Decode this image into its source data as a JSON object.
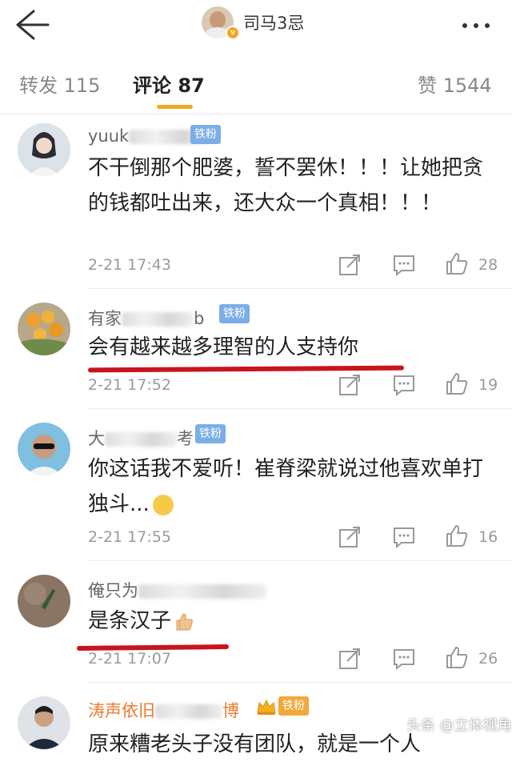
{
  "header": {
    "title": "司马3忌",
    "verified_badge": "v"
  },
  "tabs": [
    {
      "label": "转发 115"
    },
    {
      "label": "评论 87"
    },
    {
      "label": "赞 1544"
    }
  ],
  "fan_badge": "铁粉",
  "comments": [
    {
      "user_visible": "yuuk",
      "text": "不干倒那个肥婆，誓不罢休！！！让她把贪的钱都吐出来，还大众一个真相！！！",
      "time": "2-21 17:43",
      "likes": "28"
    },
    {
      "user_visible": "有家",
      "user_tail": "b",
      "text": "会有越来越多理智的人支持你",
      "time": "2-21 17:52",
      "likes": "19"
    },
    {
      "user_visible": "大",
      "user_tail": "考",
      "text": "你这话我不爱听！崔脊梁就说过他喜欢单打独斗...",
      "time": "2-21 17:55",
      "likes": "16"
    },
    {
      "user_visible": "俺只为",
      "text": "是条汉子",
      "time": "2-21 17:07",
      "likes": "26"
    },
    {
      "user_visible": "涛声依旧",
      "user_tail": "博",
      "text": "原来糟老头子没有团队，就是一个人"
    }
  ],
  "watermark": "头条 @立体视角",
  "colors": {
    "accent": "#f5a623",
    "fan_badge": "#7aaee6",
    "highlight_line": "#c8141e"
  }
}
